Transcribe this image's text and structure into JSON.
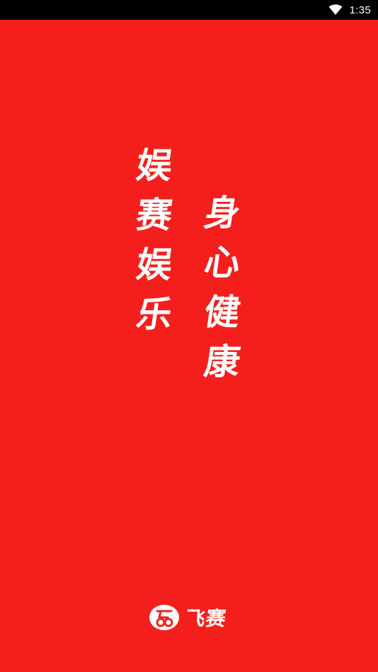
{
  "status_bar": {
    "time": "1:35",
    "wifi_icon": "wifi-icon"
  },
  "slogan": {
    "left_column": [
      "娱",
      "赛",
      "娱",
      "乐"
    ],
    "right_column": [
      "身",
      "心",
      "健",
      "康"
    ]
  },
  "brand": {
    "logo_icon": "feisai-logo-icon",
    "name": "飞赛"
  },
  "colors": {
    "background": "#f41f1c",
    "status_bar": "#000000",
    "text": "#ffffff"
  }
}
